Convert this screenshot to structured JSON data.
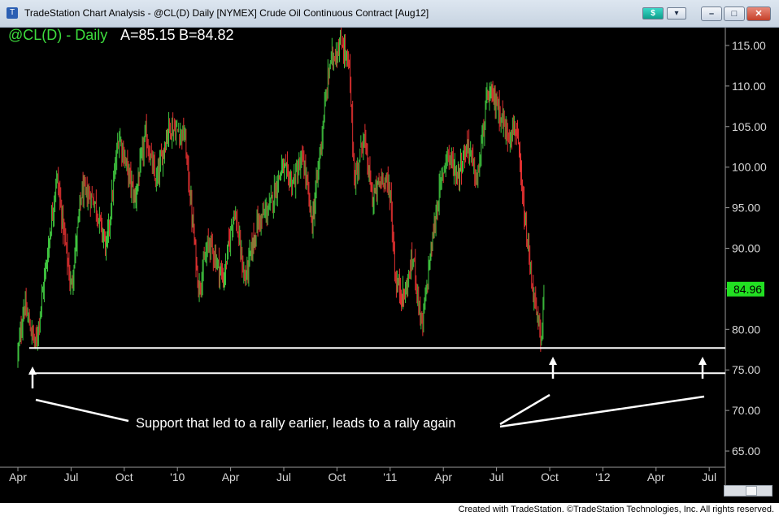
{
  "window": {
    "title": "TradeStation Chart Analysis - @CL(D) Daily [NYMEX] Crude Oil Continuous Contract [Aug12]",
    "dollar_icon": "$",
    "menu_icon": "▾"
  },
  "colors": {
    "background": "#000000",
    "up_bar": "#3fc43f",
    "down_bar": "#e03030",
    "support_line": "#ffffff",
    "last_price_tag": "#22e022",
    "header_text": "#3ddc3d"
  },
  "chart_header": {
    "symbol": "@CL(D) - Daily",
    "a_label": "A=85.15",
    "b_label": "B=84.82"
  },
  "last_price_tag": "84.96",
  "annotation": "Support that led to a rally earlier, leads to a rally again",
  "footer": "Created with TradeStation. ©TradeStation Technologies, Inc. All rights reserved.",
  "chart_data": {
    "type": "bar",
    "title": "@CL(D) - Daily",
    "xlabel": "",
    "ylabel": "",
    "ylim": [
      62.5,
      117.5
    ],
    "y_ticks": [
      "115.00",
      "110.00",
      "105.00",
      "100.00",
      "95.00",
      "90.00",
      "85.00",
      "80.00",
      "75.00",
      "70.00",
      "65.00"
    ],
    "x_ticks": [
      "Apr",
      "Jul",
      "Oct",
      "'10",
      "Apr",
      "Jul",
      "Oct",
      "'11",
      "Apr",
      "Jul",
      "Oct",
      "'12",
      "Apr",
      "Jul"
    ],
    "last_price": 84.96,
    "support_levels": [
      77.7,
      74.6
    ],
    "grid": false,
    "path_anchors": [
      {
        "t": 0.0,
        "v": 77.0
      },
      {
        "t": 0.35,
        "v": 83.0
      },
      {
        "t": 1.0,
        "v": 78.0
      },
      {
        "t": 1.6,
        "v": 88.0
      },
      {
        "t": 2.2,
        "v": 99.0
      },
      {
        "t": 3.0,
        "v": 85.0
      },
      {
        "t": 3.6,
        "v": 97.0
      },
      {
        "t": 4.3,
        "v": 96.0
      },
      {
        "t": 5.0,
        "v": 90.0
      },
      {
        "t": 5.7,
        "v": 104.0
      },
      {
        "t": 6.6,
        "v": 96.0
      },
      {
        "t": 7.2,
        "v": 104.0
      },
      {
        "t": 7.8,
        "v": 98.0
      },
      {
        "t": 8.5,
        "v": 105.0
      },
      {
        "t": 9.4,
        "v": 104.0
      },
      {
        "t": 10.2,
        "v": 85.0
      },
      {
        "t": 10.8,
        "v": 91.0
      },
      {
        "t": 11.6,
        "v": 86.0
      },
      {
        "t": 12.2,
        "v": 95.0
      },
      {
        "t": 12.8,
        "v": 86.0
      },
      {
        "t": 13.5,
        "v": 93.0
      },
      {
        "t": 14.2,
        "v": 95.0
      },
      {
        "t": 14.9,
        "v": 100.0
      },
      {
        "t": 15.5,
        "v": 98.0
      },
      {
        "t": 16.1,
        "v": 101.0
      },
      {
        "t": 16.6,
        "v": 93.0
      },
      {
        "t": 17.0,
        "v": 101.0
      },
      {
        "t": 17.6,
        "v": 113.0
      },
      {
        "t": 18.3,
        "v": 115.5
      },
      {
        "t": 18.7,
        "v": 112.0
      },
      {
        "t": 19.0,
        "v": 98.0
      },
      {
        "t": 19.5,
        "v": 104.0
      },
      {
        "t": 20.0,
        "v": 96.0
      },
      {
        "t": 20.6,
        "v": 99.0
      },
      {
        "t": 21.0,
        "v": 97.0
      },
      {
        "t": 21.3,
        "v": 86.0
      },
      {
        "t": 21.8,
        "v": 84.0
      },
      {
        "t": 22.3,
        "v": 89.0
      },
      {
        "t": 22.8,
        "v": 80.0
      },
      {
        "t": 23.2,
        "v": 88.0
      },
      {
        "t": 23.7,
        "v": 96.0
      },
      {
        "t": 24.2,
        "v": 102.0
      },
      {
        "t": 24.8,
        "v": 99.0
      },
      {
        "t": 25.4,
        "v": 103.0
      },
      {
        "t": 25.9,
        "v": 98.0
      },
      {
        "t": 26.5,
        "v": 109.0
      },
      {
        "t": 27.0,
        "v": 108.0
      },
      {
        "t": 27.6,
        "v": 104.0
      },
      {
        "t": 28.1,
        "v": 105.0
      },
      {
        "t": 28.6,
        "v": 93.0
      },
      {
        "t": 29.1,
        "v": 84.0
      },
      {
        "t": 29.5,
        "v": 78.5
      },
      {
        "t": 29.7,
        "v": 84.9
      }
    ]
  }
}
